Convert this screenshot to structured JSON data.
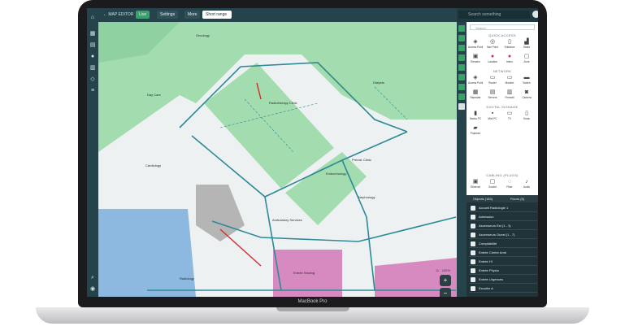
{
  "device": {
    "brand": "MacBook Pro"
  },
  "topbar": {
    "back_label": "MAP EDITOR",
    "live_label": "Live",
    "settings_label": "Settings",
    "more_label": "More",
    "range_label": "Short range"
  },
  "header": {
    "search_placeholder": "Search something"
  },
  "panel": {
    "search_placeholder": "Search",
    "sections": [
      {
        "title": "QUICK ACCESS",
        "items": [
          "Access Point",
          "Nav Point",
          "Entrance",
          "Stairs",
          "Elevator",
          "Location",
          "Intero",
          "Zone"
        ]
      },
      {
        "title": "NETWORK",
        "items": [
          "Access Point",
          "Router",
          "Modem",
          "Switch",
          "Repeater",
          "Servers",
          "Firewall",
          "Camera"
        ]
      },
      {
        "title": "DIGITAL SIGNAGE",
        "items": [
          "Media PC",
          "Mini PC",
          "TV",
          "Kiosk",
          "Projector"
        ]
      },
      {
        "title": "CABLING (PLUGS)",
        "items": [
          "Ethernet",
          "Socket",
          "Fiber",
          "Audio"
        ]
      }
    ],
    "tabs": [
      "Objects (183)",
      "Floors (5)"
    ],
    "list": [
      "Accueil Radiologie 1",
      "Admission",
      "Ascenseurs Est (1 - 3)",
      "Ascenseurs Ouest (1 - 7)",
      "Comptabilité",
      "Entrée Centre Amb",
      "Entrée Hl",
      "Entrée Physio",
      "Entrée Urgences",
      "Escalier A"
    ]
  },
  "map": {
    "labels": [
      "Oncology",
      "Day Care",
      "Radiotherapy Clinic",
      "Dialysis",
      "Cardiology",
      "Endocrinology",
      "Prenat. Clinic",
      "Nephrology",
      "Ambulatory Services",
      "Entrée Sewing",
      "Radiology"
    ],
    "zoom_level": "11 - 100%"
  }
}
